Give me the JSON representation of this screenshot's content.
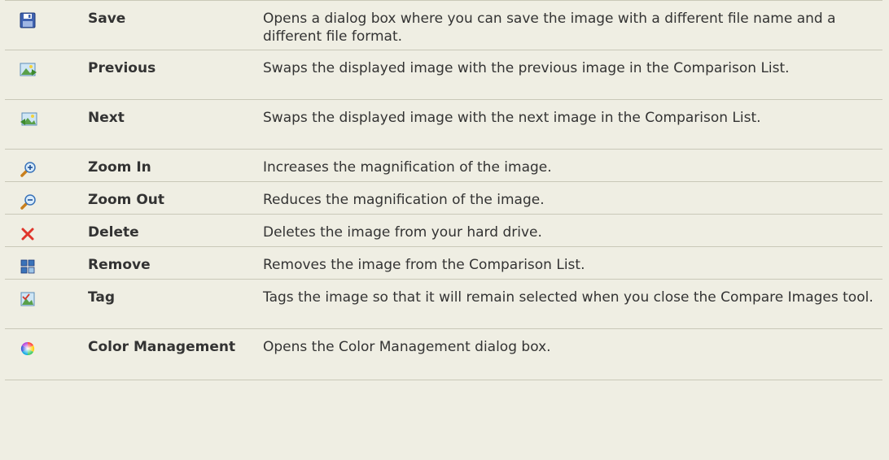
{
  "rows": [
    {
      "name": "Save",
      "description": "Opens a dialog box where you can save the image with a different file name and a different file format.",
      "icon": "floppy-disk-icon"
    },
    {
      "name": "Previous",
      "description": "Swaps the displayed image with the previous image in the Comparison List.",
      "icon": "previous-image-icon"
    },
    {
      "name": "Next",
      "description": "Swaps the displayed image with the next image in the Comparison List.",
      "icon": "next-image-icon"
    },
    {
      "name": "Zoom In",
      "description": "Increases the magnification of the image.",
      "icon": "zoom-in-icon"
    },
    {
      "name": "Zoom Out",
      "description": "Reduces the magnification of the image.",
      "icon": "zoom-out-icon"
    },
    {
      "name": "Delete",
      "description": "Deletes the image from your hard drive.",
      "icon": "delete-x-icon"
    },
    {
      "name": "Remove",
      "description": "Removes the image from the Comparison List.",
      "icon": "remove-image-icon"
    },
    {
      "name": "Tag",
      "description": "Tags the image so that it will remain selected when you close the Compare Images tool.",
      "icon": "tag-image-icon"
    },
    {
      "name": "Color Management",
      "description": "Opens the Color Management dialog box.",
      "icon": "color-wheel-icon"
    }
  ]
}
